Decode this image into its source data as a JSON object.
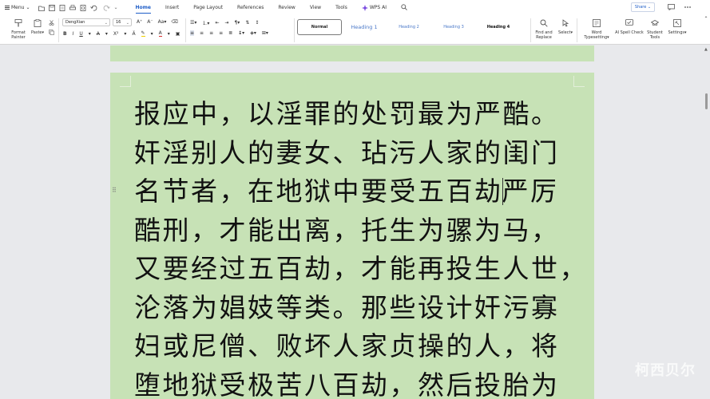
{
  "topbar": {
    "menu_label": "Menu",
    "tabs": [
      "Home",
      "Insert",
      "Page Layout",
      "References",
      "Review",
      "View",
      "Tools"
    ],
    "wps_ai_label": "WPS AI",
    "share_label": "Share"
  },
  "ribbon": {
    "format_painter_line1": "Format",
    "format_painter_line2": "Painter",
    "paste_label": "Paste",
    "font_name": "DengXian",
    "font_size": "16",
    "styles": [
      "Normal",
      "Heading 1",
      "Heading 2",
      "Heading 3",
      "Heading 4"
    ],
    "find_replace_line1": "Find and",
    "find_replace_line2": "Replace",
    "select_label": "Select",
    "word_typesetting_line1": "Word",
    "word_typesetting_line2": "Typesetting",
    "ai_spell_check_label": "AI Spell Check",
    "student_tools_line1": "Student",
    "student_tools_line2": "Tools",
    "settings_label": "Settings"
  },
  "document": {
    "lines": [
      "报应中，以淫罪的处罚最为严酷。",
      "奸淫别人的妻女、玷污人家的闺门",
      "名节者，在地狱中要受五百劫",
      "酷刑，才能出离，托生为骡为马，",
      "又要经过五百劫，才能再投生人世，",
      "沦落为娼妓等类。那些设计奸污寡",
      "妇或尼僧、败坏人家贞操的人，将",
      "堕地狱受极苦八百劫，然后投胎为"
    ],
    "line3_after_caret": "严厉"
  },
  "watermark": "柯西贝尔"
}
